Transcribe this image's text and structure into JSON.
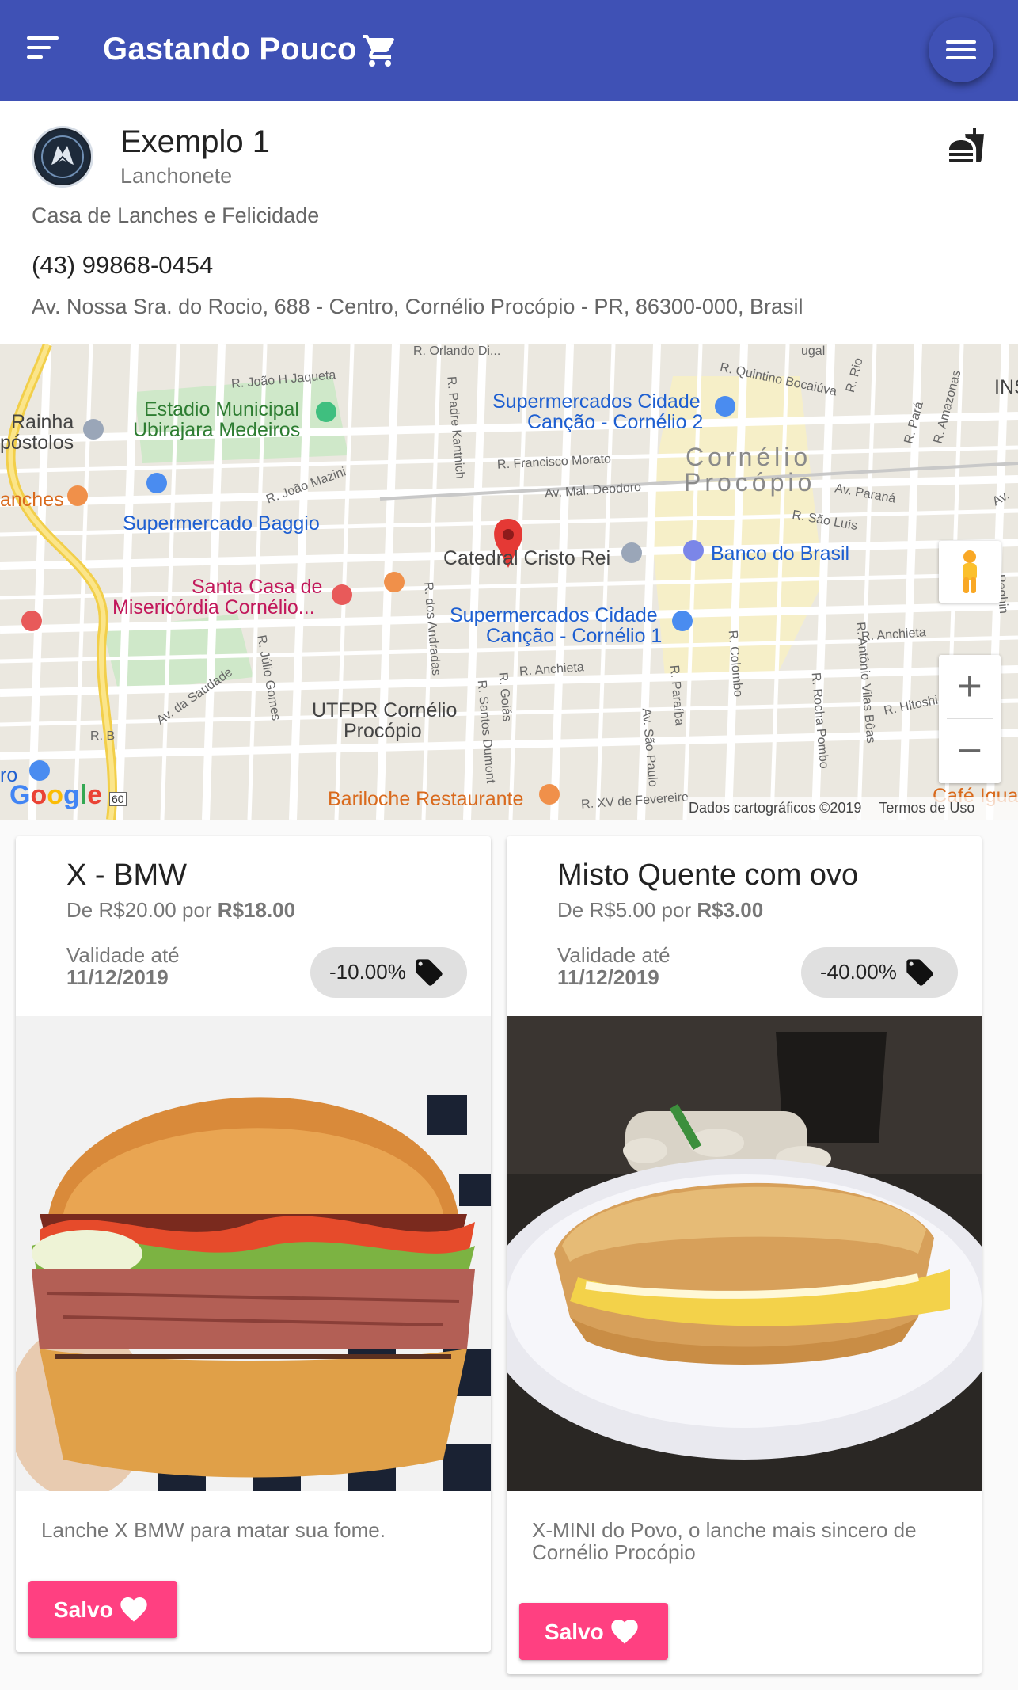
{
  "appbar": {
    "title": "Gastando Pouco"
  },
  "store": {
    "name": "Exemplo 1",
    "category": "Lanchonete",
    "description": "Casa de Lanches e Felicidade",
    "phone": "(43) 99868-0454",
    "address": "Av. Nossa Sra. do Rocio, 688 - Centro, Cornélio Procópio - PR, 86300-000, Brasil"
  },
  "map": {
    "labels": {
      "estadio": "Estadio Municipal",
      "estadio2": "Ubirajara Medeiros",
      "super_cidade2": "Supermercados Cidade",
      "super_cidade2b": "Canção - Cornélio 2",
      "super_baggio": "Supermercado Baggio",
      "catedral": "Catedral Cristo Rei",
      "banco": "Banco do Brasil",
      "santa_casa": "Santa Casa de",
      "santa_casa2": "Misericórdia Cornélio...",
      "super_cidade1": "Supermercados Cidade",
      "super_cidade1b": "Canção - Cornélio 1",
      "utfpr": "UTFPR Cornélio",
      "utfpr2": "Procópio",
      "bariloche": "Bariloche Restaurante",
      "cafe": "Café Igua",
      "rainha": "Rainha",
      "apostolos": "póstolos",
      "lanches": "anches",
      "town1": "Cornélio",
      "town2": "Procópio",
      "ins": "INS",
      "ro": "ro"
    },
    "streets": [
      "R. Orlando Di...",
      "R. João H Jaqueta",
      "R. Padre Kantnich",
      "R. Quintino Bocaiúva",
      "R. Rio",
      "R. Pará",
      "R. Amazonas",
      "R. Francisco Morato",
      "R. João Mazini",
      "Av. Mal. Deodoro",
      "Av. Paraná",
      "R. São Luís",
      "R. dos Andradas",
      "R. Anchieta",
      "R. Anchieta",
      "R. Júlio Gomes",
      "Av. da Saudade",
      "R. Santos Dumont",
      "R. Goiás",
      "Av. São Paulo",
      "R. Paraíba",
      "R. Colombo",
      "R. Rocha Pombo",
      "R. Antônio Vilas Bôas",
      "R. Hitoshi N",
      "R. XV de Fevereiro",
      "R. B",
      "Av.",
      "Peghin",
      "ugal"
    ],
    "scale": "60",
    "google": "Google",
    "attribution": "Dados cartográficos ©2019",
    "terms": "Termos de Uso",
    "zoom_in": "+",
    "zoom_out": "−"
  },
  "offers": [
    {
      "title": "X - BMW",
      "price_prefix": "De R$20.00 por ",
      "price_new": "R$18.00",
      "valid_label": "Validade até",
      "valid_date": "11/12/2019",
      "discount": "-10.00%",
      "description": "Lanche X BMW para matar sua fome.",
      "saved_label": "Salvo"
    },
    {
      "title": "Misto Quente com ovo",
      "price_prefix": "De R$5.00 por ",
      "price_new": "R$3.00",
      "valid_label": "Validade até",
      "valid_date": "11/12/2019",
      "discount": "-40.00%",
      "description": "X-MINI do Povo, o lanche mais sincero de Cornélio Procópio",
      "saved_label": "Salvo"
    }
  ],
  "colors": {
    "primary": "#3f51b5",
    "accent": "#ff4081",
    "chip": "#e0e0e0"
  },
  "icons": [
    "menu-icon",
    "cart-icon",
    "hamburger-menu-icon",
    "food-icon",
    "tag-icon",
    "heart-icon",
    "map-pin-icon",
    "pegman-icon"
  ]
}
